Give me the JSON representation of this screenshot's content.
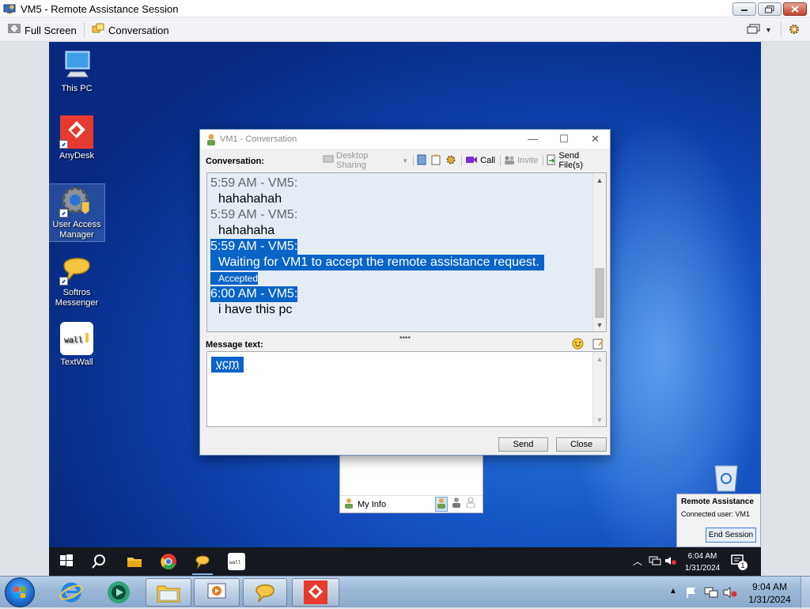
{
  "window": {
    "title": "VM5 - Remote Assistance Session"
  },
  "toolbar": {
    "full_screen": "Full Screen",
    "conversation": "Conversation"
  },
  "desktop_icons": [
    {
      "label": "This PC"
    },
    {
      "label": "AnyDesk"
    },
    {
      "label": "User Access Manager"
    },
    {
      "label": "Softros Messenger"
    },
    {
      "label": "TextWall"
    }
  ],
  "conversation_window": {
    "title": "VM1 - Conversation",
    "conversation_label": "Conversation:",
    "tools": {
      "desktop_sharing": "Desktop Sharing",
      "call": "Call",
      "invite": "Invite",
      "send_files": "Send File(s)"
    },
    "messages": [
      {
        "header": "5:59 AM - VM5:",
        "text": "hahahahah"
      },
      {
        "header": "5:59 AM - VM5:",
        "text": "hahahaha"
      },
      {
        "header": "5:59 AM - VM5:",
        "text": "Waiting for VM1 to accept the remote assistance request.",
        "status": "Accepted"
      },
      {
        "header": "6:00 AM - VM5:",
        "text": "i have this pc"
      }
    ],
    "message_label": "Message text:",
    "message_value": "vcm",
    "send_button": "Send",
    "close_button": "Close"
  },
  "my_info": {
    "label": "My Info"
  },
  "ra_popup": {
    "title": "Remote Assistance",
    "connected": "Connected user: VM1",
    "end_session": "End Session"
  },
  "remote_taskbar": {
    "time": "6:04 AM",
    "date": "1/31/2024",
    "notification_count": "1"
  },
  "host_taskbar": {
    "time": "9:04 AM",
    "date": "1/31/2024"
  },
  "colors": {
    "selection": "#0a64c8",
    "desktop_blue": "#1554c4",
    "anydesk_red": "#e63a2e"
  }
}
